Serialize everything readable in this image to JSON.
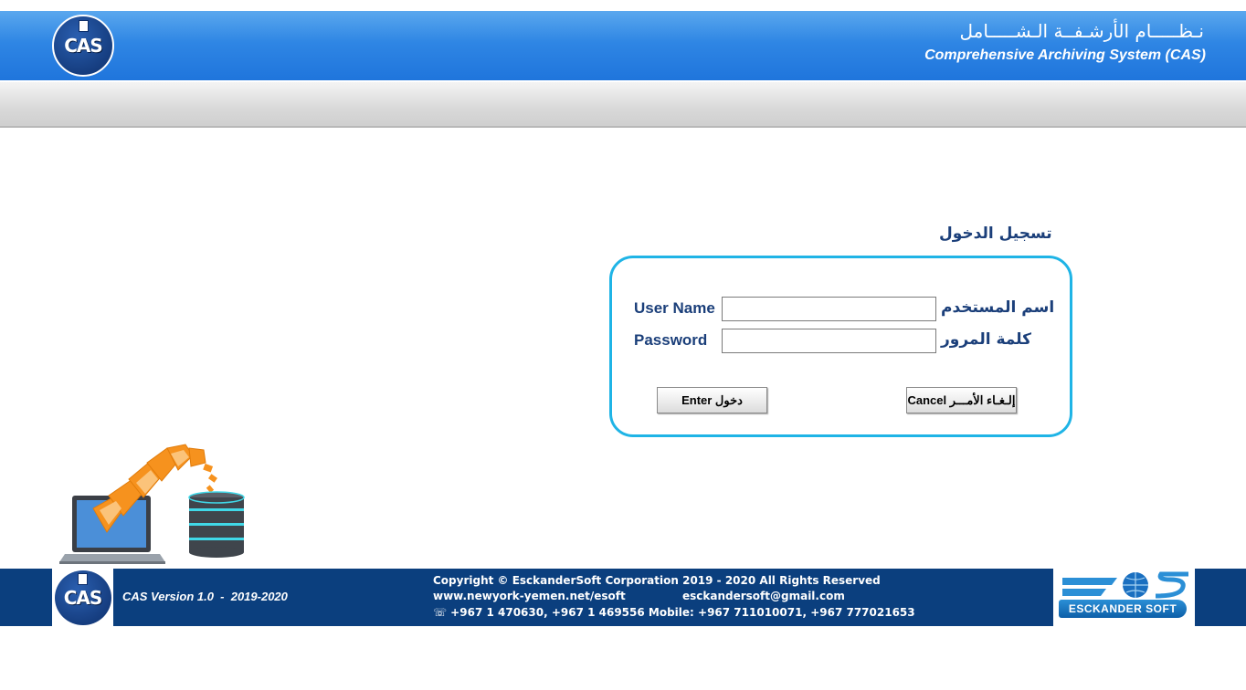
{
  "header": {
    "logo_text": "CAS",
    "title_ar": "نـظـــــام الأرشـفــة الـشـــــامل",
    "title_en": "Comprehensive Archiving System (CAS)"
  },
  "login": {
    "title": "تسجيل الدخول",
    "username_label_en": "User Name",
    "username_label_ar": "اسم المستخدم",
    "username_value": "",
    "password_label_en": "Password",
    "password_label_ar": "كلمة المرور",
    "password_value": "",
    "enter_label": "Enter دخول",
    "cancel_label": "Cancel إلـغـاء الأمـــر"
  },
  "footer": {
    "logo_text": "CAS",
    "version": "CAS Version 1.0  -  2019-2020",
    "copyright": "Copyright © EsckanderSoft Corporation 2019 - 2020   All Rights Reserved",
    "website": "www.newyork-yemen.net/esoft",
    "email": "esckandersoft@gmail.com",
    "phone": "☏ +967 1 470630, +967 1 469556  Mobile: +967 711010071, +967 777021653",
    "brand_logo": "ESCKANDER SOFT",
    "brand_letters": "EOS"
  },
  "icons": {
    "header_logo": "cas-logo-icon",
    "illustration": "laptop-folders-database-icon",
    "footer_brand": "esckander-soft-logo-icon"
  },
  "colors": {
    "header_blue": "#2f86e4",
    "footer_blue": "#0b3f7e",
    "login_border": "#1fb4e6",
    "label_text": "#1b3f7a"
  }
}
